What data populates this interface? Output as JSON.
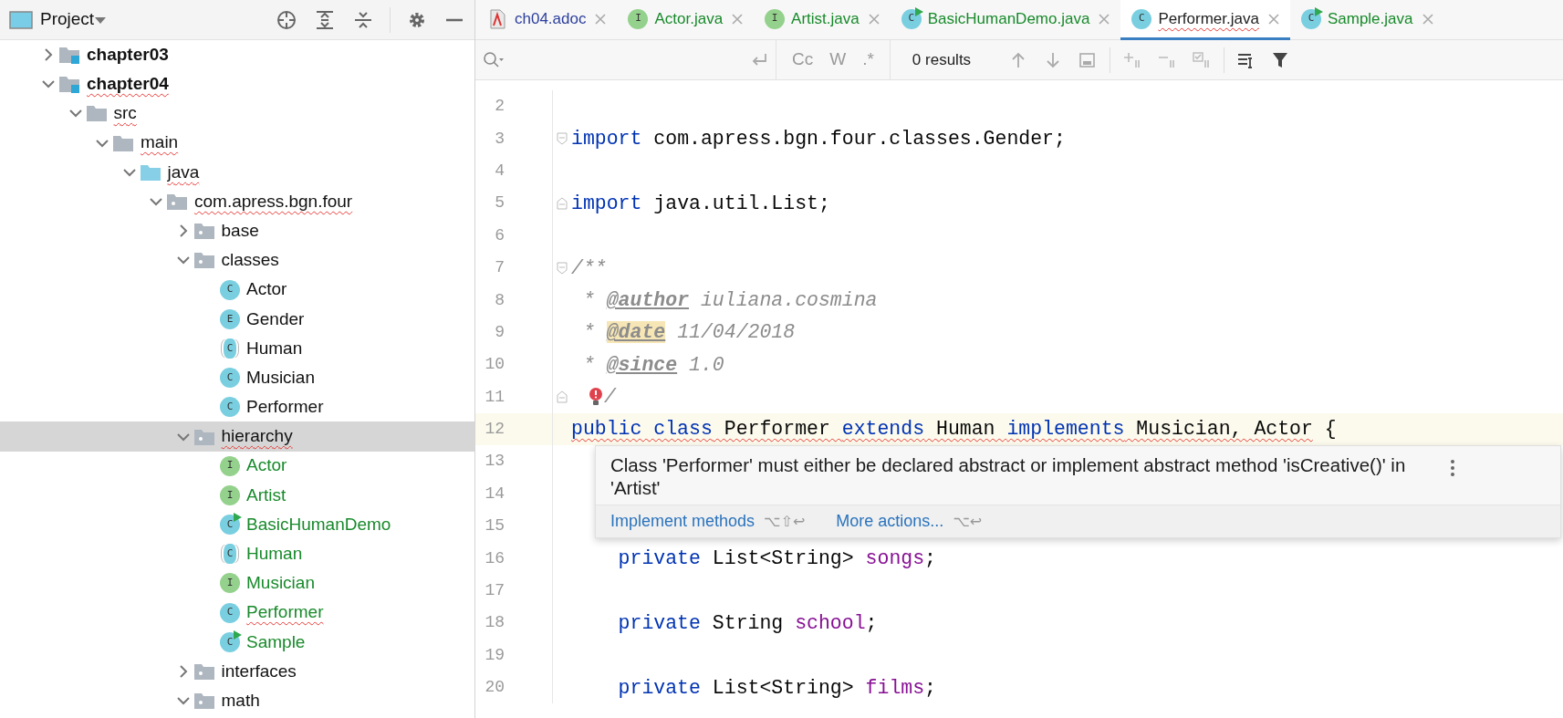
{
  "project_panel": {
    "title": "Project",
    "tree": [
      {
        "label": "chapter03",
        "kind": "module",
        "expanded": false,
        "bold": true,
        "selected": false
      },
      {
        "label": "chapter04",
        "kind": "module",
        "expanded": true,
        "bold": true,
        "misspelled": true,
        "selected": false,
        "children": [
          {
            "label": "src",
            "kind": "folder",
            "expanded": true,
            "misspelled": true,
            "selected": false,
            "children": [
              {
                "label": "main",
                "kind": "folder",
                "expanded": true,
                "misspelled": true,
                "selected": false,
                "children": [
                  {
                    "label": "java",
                    "kind": "source-folder",
                    "expanded": true,
                    "misspelled": true,
                    "selected": false,
                    "children": [
                      {
                        "label": "com.apress.bgn.four",
                        "kind": "package",
                        "expanded": true,
                        "misspelled": true,
                        "selected": false,
                        "children": [
                          {
                            "label": "base",
                            "kind": "package",
                            "expanded": false,
                            "selected": false
                          },
                          {
                            "label": "classes",
                            "kind": "package",
                            "expanded": true,
                            "selected": false,
                            "children": [
                              {
                                "label": "Actor",
                                "kind": "class",
                                "badge": "C",
                                "selected": false
                              },
                              {
                                "label": "Gender",
                                "kind": "enum",
                                "badge": "E",
                                "selected": false
                              },
                              {
                                "label": "Human",
                                "kind": "abstract",
                                "badge": "C",
                                "selected": false
                              },
                              {
                                "label": "Musician",
                                "kind": "class",
                                "badge": "C",
                                "selected": false
                              },
                              {
                                "label": "Performer",
                                "kind": "class",
                                "badge": "C",
                                "selected": false
                              }
                            ]
                          },
                          {
                            "label": "hierarchy",
                            "kind": "package",
                            "expanded": true,
                            "misspelled": true,
                            "selected": true,
                            "children": [
                              {
                                "label": "Actor",
                                "kind": "interface",
                                "badge": "I",
                                "color": "#188a2b",
                                "selected": false
                              },
                              {
                                "label": "Artist",
                                "kind": "interface",
                                "badge": "I",
                                "color": "#188a2b",
                                "selected": false
                              },
                              {
                                "label": "BasicHumanDemo",
                                "kind": "runnable",
                                "badge": "C",
                                "color": "#188a2b",
                                "selected": false
                              },
                              {
                                "label": "Human",
                                "kind": "abstract",
                                "badge": "C",
                                "color": "#188a2b",
                                "selected": false
                              },
                              {
                                "label": "Musician",
                                "kind": "interface",
                                "badge": "I",
                                "color": "#188a2b",
                                "selected": false
                              },
                              {
                                "label": "Performer",
                                "kind": "class",
                                "badge": "C",
                                "color": "#188a2b",
                                "misspelled": true,
                                "selected": false
                              },
                              {
                                "label": "Sample",
                                "kind": "runnable",
                                "badge": "C",
                                "color": "#188a2b",
                                "selected": false
                              }
                            ]
                          },
                          {
                            "label": "interfaces",
                            "kind": "package",
                            "expanded": false,
                            "selected": false
                          },
                          {
                            "label": "math",
                            "kind": "package",
                            "expanded": true,
                            "selected": false
                          }
                        ]
                      }
                    ]
                  }
                ]
              }
            ]
          }
        ]
      }
    ]
  },
  "tabs": [
    {
      "label": "ch04.adoc",
      "kind": "adoc",
      "color": "#2b3e9c",
      "selected": false
    },
    {
      "label": "Actor.java",
      "kind": "interface",
      "badge": "I",
      "color": "#188a2b",
      "selected": false
    },
    {
      "label": "Artist.java",
      "kind": "interface",
      "badge": "I",
      "color": "#188a2b",
      "selected": false
    },
    {
      "label": "BasicHumanDemo.java",
      "kind": "runnable",
      "badge": "C",
      "color": "#188a2b",
      "selected": false
    },
    {
      "label": "Performer.java",
      "kind": "class",
      "badge": "C",
      "color": "#222222",
      "misspelled": true,
      "selected": true
    },
    {
      "label": "Sample.java",
      "kind": "runnable",
      "badge": "C",
      "color": "#188a2b",
      "selected": false
    }
  ],
  "find_bar": {
    "options": [
      "Cc",
      "W",
      ".*"
    ],
    "results": "0 results"
  },
  "code_lines": [
    {
      "number": "2",
      "current": false
    },
    {
      "number": "3",
      "current": false,
      "fold_start": true,
      "tokens": [
        {
          "text": "import",
          "kind": "keyword"
        },
        {
          "text": " com.apress.bgn.four.classes.Gender;",
          "kind": "plain"
        }
      ]
    },
    {
      "number": "4",
      "current": false
    },
    {
      "number": "5",
      "current": false,
      "fold_end": true,
      "tokens": [
        {
          "text": "import",
          "kind": "keyword"
        },
        {
          "text": " java.util.List;",
          "kind": "plain"
        }
      ]
    },
    {
      "number": "6",
      "current": false
    },
    {
      "number": "7",
      "current": false,
      "fold_start": true,
      "tokens": [
        {
          "text": "/**",
          "kind": "comment"
        }
      ]
    },
    {
      "number": "8",
      "current": false,
      "tokens": [
        {
          "text": " * ",
          "kind": "comment"
        },
        {
          "text": "@author",
          "kind": "doctag"
        },
        {
          "text": " iuliana.cosmina",
          "kind": "comment"
        }
      ]
    },
    {
      "number": "9",
      "current": false,
      "tokens": [
        {
          "text": " * ",
          "kind": "comment"
        },
        {
          "text": "@date",
          "kind": "doctag",
          "highlighted": true
        },
        {
          "text": " 11/04/2018",
          "kind": "comment"
        }
      ]
    },
    {
      "number": "10",
      "current": false,
      "tokens": [
        {
          "text": " * ",
          "kind": "comment"
        },
        {
          "text": "@since",
          "kind": "doctag"
        },
        {
          "text": " 1.0",
          "kind": "comment"
        }
      ]
    },
    {
      "number": "11",
      "current": false,
      "fold_end": true,
      "error_bulb": true,
      "tokens": [
        {
          "text": "/",
          "kind": "comment"
        }
      ]
    },
    {
      "number": "12",
      "current": true,
      "tokens": [
        {
          "text": "public class",
          "kind": "keyword",
          "error": true
        },
        {
          "text": " Performer ",
          "kind": "plain",
          "error": true
        },
        {
          "text": "extends",
          "kind": "keyword",
          "error": true
        },
        {
          "text": " Human ",
          "kind": "plain",
          "error": true
        },
        {
          "text": "implements",
          "kind": "keyword",
          "error": true
        },
        {
          "text": " Musician, Actor",
          "kind": "plain",
          "error": true
        },
        {
          "text": " {",
          "kind": "plain"
        }
      ]
    },
    {
      "number": "13",
      "current": false
    },
    {
      "number": "14",
      "current": false
    },
    {
      "number": "15",
      "current": false
    },
    {
      "number": "16",
      "current": false,
      "tokens": [
        {
          "text": "    private",
          "kind": "keyword"
        },
        {
          "text": " List<String> ",
          "kind": "plain"
        },
        {
          "text": "songs",
          "kind": "field"
        },
        {
          "text": ";",
          "kind": "plain"
        }
      ]
    },
    {
      "number": "17",
      "current": false
    },
    {
      "number": "18",
      "current": false,
      "tokens": [
        {
          "text": "    private",
          "kind": "keyword"
        },
        {
          "text": " String ",
          "kind": "plain"
        },
        {
          "text": "school",
          "kind": "field"
        },
        {
          "text": ";",
          "kind": "plain"
        }
      ]
    },
    {
      "number": "19",
      "current": false
    },
    {
      "number": "20",
      "current": false,
      "tokens": [
        {
          "text": "    private",
          "kind": "keyword"
        },
        {
          "text": " List<String> ",
          "kind": "plain"
        },
        {
          "text": "films",
          "kind": "field"
        },
        {
          "text": ";",
          "kind": "plain"
        }
      ]
    }
  ],
  "error_popup": {
    "message": "Class 'Performer' must either be declared abstract or implement abstract method 'isCreative()' in 'Artist'",
    "actions": [
      {
        "label": "Implement methods",
        "shortcut": "⌥⇧↩"
      },
      {
        "label": "More actions...",
        "shortcut": "⌥↩"
      }
    ]
  }
}
